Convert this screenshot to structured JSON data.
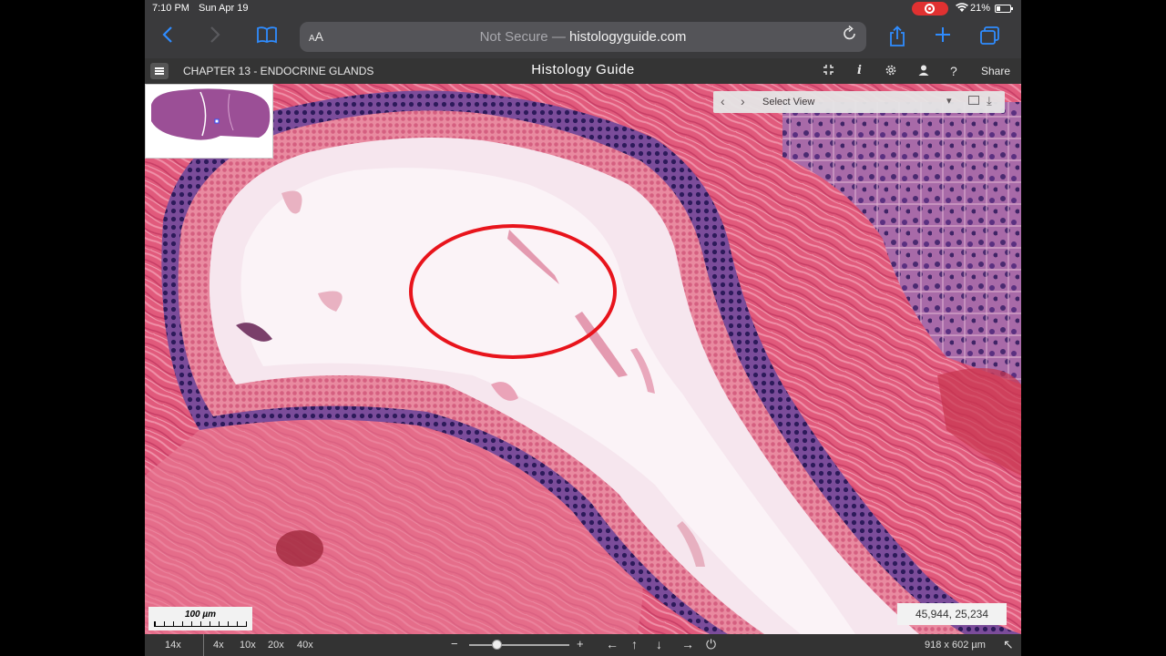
{
  "status_bar": {
    "time": "7:10 PM",
    "date": "Sun Apr 19",
    "battery": "21%"
  },
  "browser": {
    "text_size_small": "A",
    "text_size_large": "A",
    "security_label": "Not Secure",
    "separator": "—",
    "domain": "histologyguide.com"
  },
  "app_header": {
    "chapter": "CHAPTER 13 - ENDOCRINE GLANDS",
    "title": "Histology Guide",
    "share_label": "Share"
  },
  "viewer": {
    "select_view_label": "Select View",
    "scale_bar_label": "100 µm",
    "coordinates": "45,944,  25,234"
  },
  "bottom_bar": {
    "current_zoom": "14x",
    "zoom_presets": [
      "4x",
      "10x",
      "20x",
      "40x"
    ],
    "zoom_out": "−",
    "zoom_in": "+",
    "zoom_level": 0.28,
    "dimensions": "918 x 602 µm"
  },
  "colors": {
    "annotation": "#e8141c",
    "safari_accent": "#2f8cff",
    "record_indicator": "#e03131"
  }
}
